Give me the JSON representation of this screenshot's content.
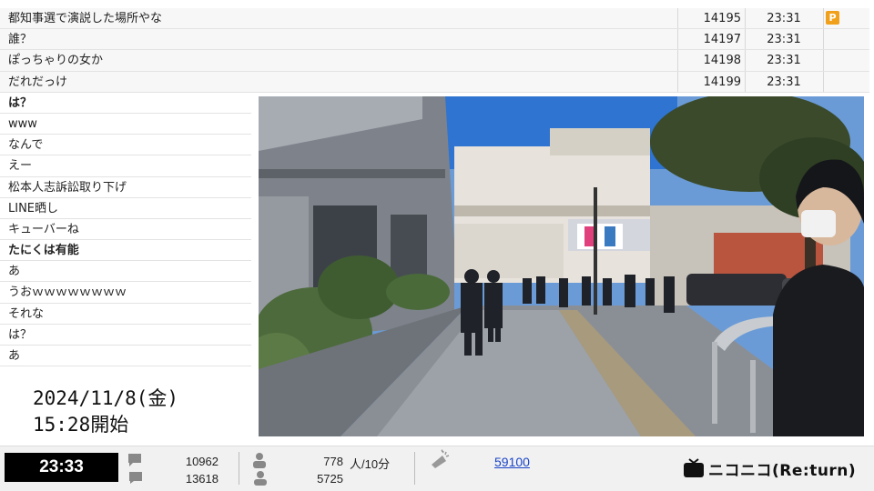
{
  "comments_full": [
    {
      "text": "都知事選で演説した場所やな",
      "num": "14195",
      "time": "23:31",
      "premium": true,
      "premium_label": "P"
    },
    {
      "text": "誰？",
      "num": "14197",
      "time": "23:31"
    },
    {
      "text": "ぽっちゃりの女か",
      "num": "14198",
      "time": "23:31"
    },
    {
      "text": "だれだっけ",
      "num": "14199",
      "time": "23:31"
    }
  ],
  "comments_short": [
    {
      "text": "は？",
      "bold": true
    },
    {
      "text": "www"
    },
    {
      "text": "なんで"
    },
    {
      "text": "えー"
    },
    {
      "text": "松本人志訴訟取り下げ"
    },
    {
      "text": "LINE晒し"
    },
    {
      "text": "キューバーね"
    },
    {
      "text": "たにくは有能",
      "bold": true
    },
    {
      "text": "あ"
    },
    {
      "text": "うおｗｗｗｗｗｗｗｗ"
    },
    {
      "text": "それな"
    },
    {
      "text": "は？"
    },
    {
      "text": "あ"
    }
  ],
  "start_info": {
    "date": "2024/11/8(金)",
    "time": "15:28開始"
  },
  "bottom_bar": {
    "clock": "23:33",
    "comment_count_1": "10962",
    "comment_count_2": "13618",
    "viewers_rate": "778",
    "viewers_unit": "人/10分",
    "viewers_total": "5725",
    "ad_points": "59100",
    "logo_text": "ニコニコ(Re:turn)"
  },
  "colors": {
    "premium": "#f0a01a",
    "link": "#1a45c8",
    "clock_bg": "#000000"
  }
}
